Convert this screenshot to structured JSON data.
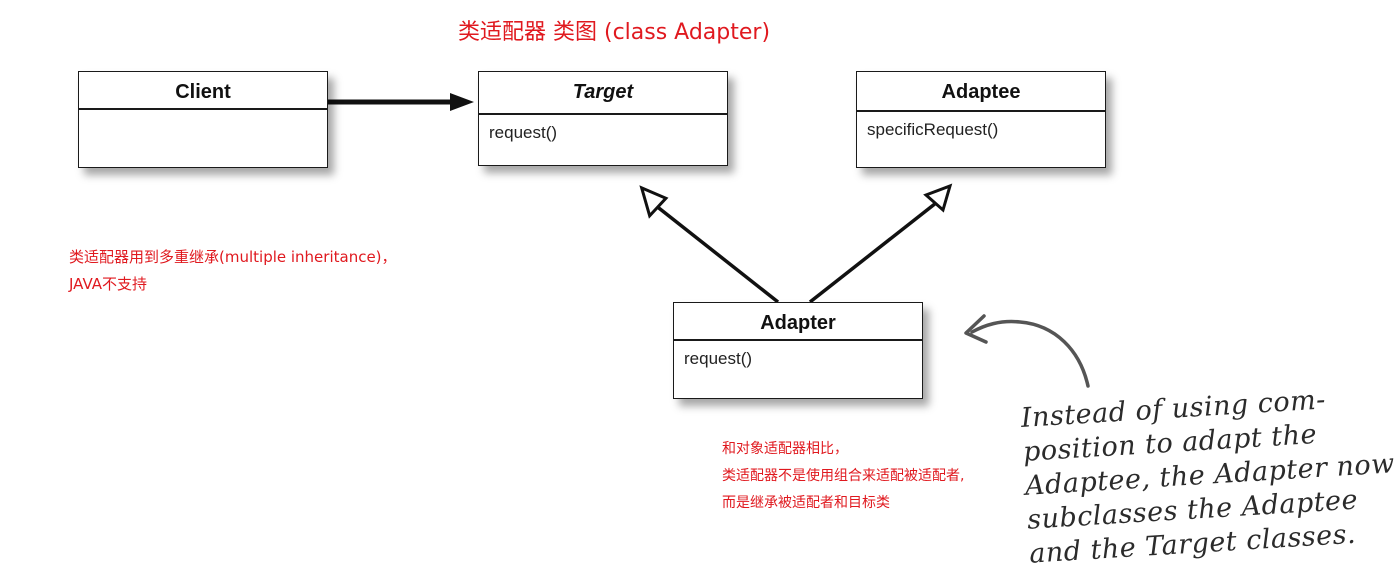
{
  "title": "类适配器 类图 (class Adapter)",
  "classes": {
    "client": {
      "name": "Client",
      "methods": []
    },
    "target": {
      "name": "Target",
      "methods": [
        "request()"
      ]
    },
    "adaptee": {
      "name": "Adaptee",
      "methods": [
        "specificRequest()"
      ]
    },
    "adapter": {
      "name": "Adapter",
      "methods": [
        "request()"
      ]
    }
  },
  "notes": {
    "inheritance": [
      "类适配器用到多重继承(multiple inheritance)，",
      "JAVA不支持"
    ],
    "comparison": [
      "和对象适配器相比，",
      "类适配器不是使用组合来适配被适配者,",
      "而是继承被适配者和目标类"
    ],
    "handwritten": [
      "Instead of using com-",
      "position to adapt the",
      "Adaptee, the Adapter now",
      "subclasses the Adaptee",
      "and the Target classes."
    ]
  },
  "colors": {
    "annotation": "#e0191f",
    "line": "#111111",
    "handwriting": "#4a4a4a"
  }
}
